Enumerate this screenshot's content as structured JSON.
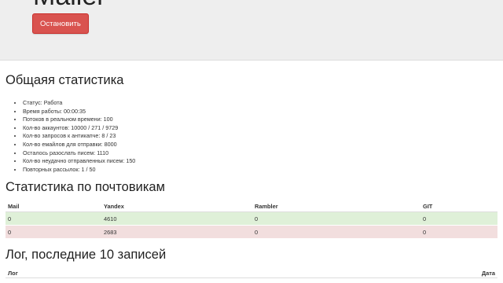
{
  "header": {
    "title": "Mailer",
    "stop_button": "Остановить"
  },
  "stats": {
    "heading": "Общаяя статистика",
    "items": [
      "Статус: Работа",
      "Время работы: 00:00:35",
      "Потоков в реальном времени: 100",
      "Кол-во аккаунтов: 10000 / 271 / 9729",
      "Кол-во запросов к антикапче: 8 / 23",
      "Кол-во емайлов для отправки: 8000",
      "Осталось разослать писем: 1110",
      "Кол-во неудачно отправленных писем: 150",
      "Повторных рассылок: 1 / 50"
    ]
  },
  "mail_stats": {
    "heading": "Статистика по почтовикам",
    "columns": [
      "Mail",
      "Yandex",
      "Rambler",
      "GIT"
    ],
    "rows": [
      {
        "status": "success",
        "cells": [
          "0",
          "4610",
          "0",
          "0"
        ]
      },
      {
        "status": "danger",
        "cells": [
          "0",
          "2683",
          "0",
          "0"
        ]
      }
    ]
  },
  "log": {
    "heading": "Лог, последние 10 записей",
    "columns": [
      "Лог",
      "Дата"
    ]
  },
  "colors": {
    "danger_button": "#d9534f",
    "success_row": "#dff0d8",
    "danger_row": "#f2dede",
    "header_bg": "#eeeeee"
  }
}
